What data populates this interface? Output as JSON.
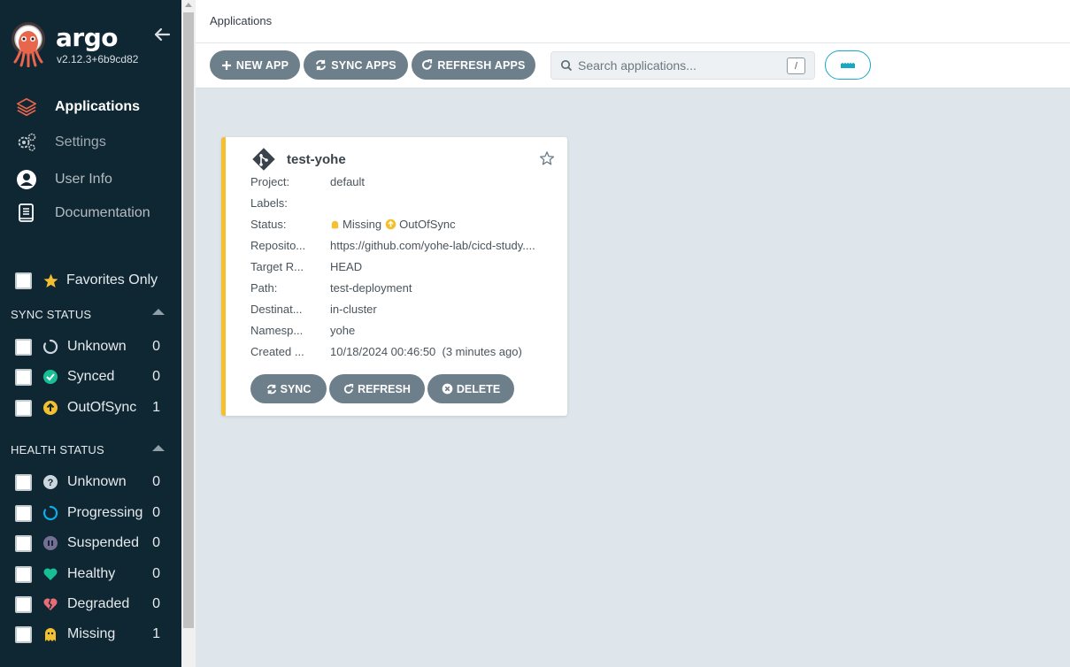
{
  "app": {
    "brand": "argo",
    "version": "v2.12.3+6b9cd82"
  },
  "nav": {
    "items": [
      {
        "label": "Applications",
        "icon": "layers-icon",
        "active": true
      },
      {
        "label": "Settings",
        "icon": "gears-icon"
      },
      {
        "label": "User Info",
        "icon": "user-circle-icon"
      },
      {
        "label": "Documentation",
        "icon": "book-icon"
      }
    ]
  },
  "filters": {
    "favorites_label": "Favorites Only",
    "sync_title": "SYNC STATUS",
    "sync": [
      {
        "label": "Unknown",
        "count": "0",
        "icon": "circle-notch-icon",
        "color": "#ccd6dd"
      },
      {
        "label": "Synced",
        "count": "0",
        "icon": "check-circle-icon",
        "color": "#18be94"
      },
      {
        "label": "OutOfSync",
        "count": "1",
        "icon": "arrow-circle-up-icon",
        "color": "#f4c030"
      }
    ],
    "health_title": "HEALTH STATUS",
    "health": [
      {
        "label": "Unknown",
        "count": "0",
        "icon": "question-circle-icon",
        "color": "#ccd6dd"
      },
      {
        "label": "Progressing",
        "count": "0",
        "icon": "circle-notch-icon",
        "color": "#0dadea"
      },
      {
        "label": "Suspended",
        "count": "0",
        "icon": "pause-circle-icon",
        "color": "#766f94"
      },
      {
        "label": "Healthy",
        "count": "0",
        "icon": "heart-icon",
        "color": "#18be94"
      },
      {
        "label": "Degraded",
        "count": "0",
        "icon": "heart-broken-icon",
        "color": "#e96d76"
      },
      {
        "label": "Missing",
        "count": "1",
        "icon": "ghost-icon",
        "color": "#f4c030"
      }
    ]
  },
  "header": {
    "breadcrumb": "Applications"
  },
  "toolbar": {
    "new_app": "NEW APP",
    "sync_apps": "SYNC APPS",
    "refresh_apps": "REFRESH APPS",
    "search_placeholder": "Search applications...",
    "search_shortcut": "/"
  },
  "card": {
    "name": "test-yohe",
    "rows": [
      {
        "key": "Project:",
        "value": "default"
      },
      {
        "key": "Labels:",
        "value": ""
      },
      {
        "key": "Status:",
        "value": ""
      },
      {
        "key": "Reposito...",
        "value": "https://github.com/yohe-lab/cicd-study...."
      },
      {
        "key": "Target R...",
        "value": "HEAD"
      },
      {
        "key": "Path:",
        "value": "test-deployment"
      },
      {
        "key": "Destinat...",
        "value": "in-cluster"
      },
      {
        "key": "Namesp...",
        "value": "yohe"
      },
      {
        "key": "Created ...",
        "value": "10/18/2024 00:46:50  (3 minutes ago)"
      }
    ],
    "health_status": "Missing",
    "sync_status": "OutOfSync",
    "sync_button": "SYNC",
    "refresh_button": "REFRESH",
    "delete_button": "DELETE"
  },
  "colors": {
    "sidebar": "#0f2733",
    "button": "#6d7f8b",
    "accent": "#18a8c2",
    "card_border": "#f4c030",
    "background": "#dee6eb"
  }
}
